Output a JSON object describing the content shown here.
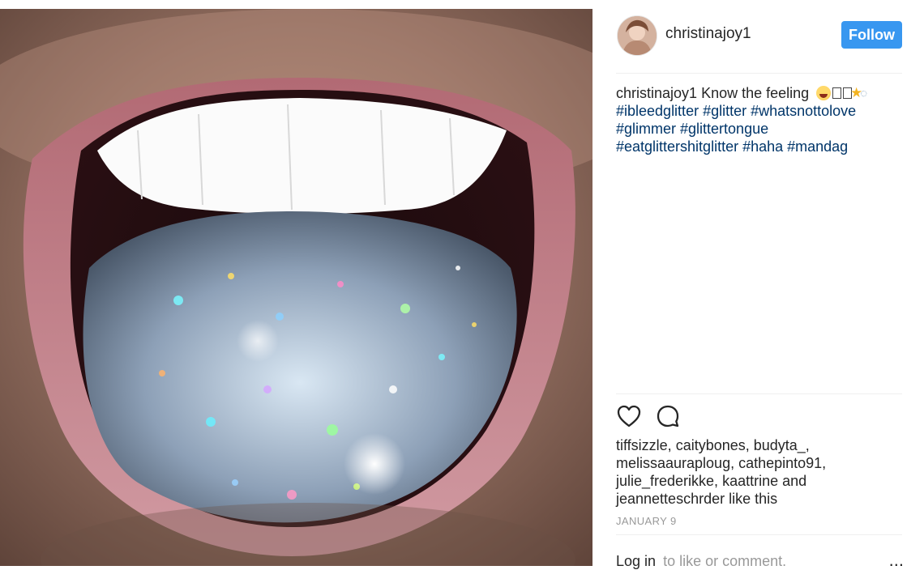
{
  "post": {
    "author": "christinajoy1",
    "follow_label": "Follow",
    "caption": {
      "handle": "christinajoy1",
      "text": "Know the feeling",
      "emoji_1": "squinting-face-tongue",
      "emoji_2": "star",
      "emoji_3": "ring",
      "hashtags_line1": "#ibleedglitter #glitter #whatsnottolove",
      "hashtags_line2": "#glimmer #glittertongue",
      "hashtags_line3": "#eatglittershitglitter #haha #mandag"
    },
    "likes": {
      "users": "tiffsizzle, caitybones, budyta_, melissaauraploug, cathepinto91, julie_frederikke, kaattrine",
      "and_text": "and",
      "last_user": "jeannetteschrder",
      "suffix": "like this"
    },
    "date": "JANUARY 9",
    "footer": {
      "login_label": "Log in",
      "suffix": "to like or comment.",
      "more_label": "..."
    },
    "icons": {
      "like": "heart-icon",
      "comment": "comment-icon",
      "more": "more-icon"
    },
    "colors": {
      "follow_bg": "#3897f0",
      "hashtag": "#003569",
      "muted": "#999999",
      "text": "#262626"
    }
  }
}
